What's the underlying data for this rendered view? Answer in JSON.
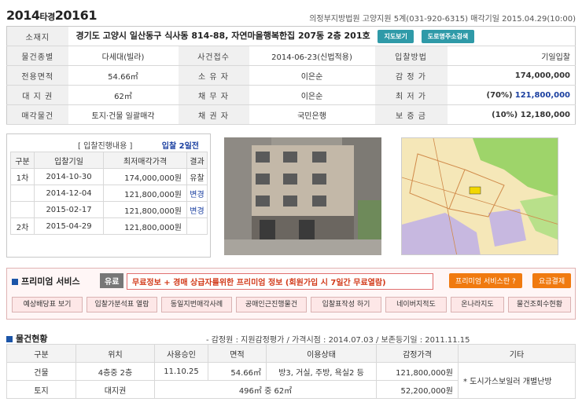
{
  "header": {
    "year": "2014",
    "type": "타경",
    "number": "20161",
    "court": "의정부지방법원 고양지원 5계(031-920-6315) 매각기일 2015.04.29(10:00)"
  },
  "info": {
    "address_label": "소재지",
    "address": "경기도 고양시 일산동구 식사동 814-88, 자연마을행복한집 207동 2층 201호",
    "map_btn": "지도보기",
    "road_btn": "도로명주소검색",
    "rows": [
      {
        "l1": "물건종별",
        "v1": "다세대(빌라)",
        "l2": "사건접수",
        "v2": "2014-06-23(신법적용)",
        "l3": "입찰방법",
        "v3": "기일입찰"
      },
      {
        "l1": "전용면적",
        "v1": "54.66㎡",
        "l2": "소 유 자",
        "v2": "이은순",
        "l3": "감 정 가",
        "v3": "174,000,000"
      },
      {
        "l1": "대 지 권",
        "v1": "62㎡",
        "l2": "채 무 자",
        "v2": "이은순",
        "l3": "최 저 가",
        "v3a": "(70%)",
        "v3b": "121,800,000"
      },
      {
        "l1": "매각물건",
        "v1": "토지·건물 일괄매각",
        "l2": "채 권 자",
        "v2": "국민은행",
        "l3": "보 증 금",
        "v3": "(10%) 12,180,000"
      }
    ]
  },
  "bid": {
    "title": "[ 입찰진행내용 ]",
    "round": "입찰 2일전",
    "headers": [
      "구분",
      "입찰기일",
      "최저매각가격",
      "결과"
    ],
    "rows": [
      {
        "div": "1차",
        "date": "2014-10-30",
        "price": "174,000,000원",
        "result": "유찰"
      },
      {
        "div": "",
        "date": "2014-12-04",
        "price": "121,800,000원",
        "result": "변경"
      },
      {
        "div": "",
        "date": "2015-02-17",
        "price": "121,800,000원",
        "result": "변경"
      },
      {
        "div": "2차",
        "date": "2015-04-29",
        "price": "121,800,000원",
        "result": ""
      }
    ]
  },
  "premium": {
    "title": "프리미엄 서비스",
    "tag": "유료",
    "message": "무료정보 + 경매 상급자를위한 프리미엄 정보 (회원가입 시 7일간 무료열람)",
    "btn_what": "프리미엄 서비스란 ?",
    "btn_pay": "요금결제",
    "services": [
      "예상배당표 보기",
      "입찰가분석표 열람",
      "동일지번매각사례",
      "공매인근진행물건",
      "입찰표작성 하기",
      "네이버지적도",
      "온나라지도",
      "물건조회수현황"
    ]
  },
  "status": {
    "title": "물건현황",
    "meta": "- 감정원 : 지원감정평가 / 가격시점 : 2014.07.03 / 보존등기일  : 2011.11.15",
    "headers": [
      "구분",
      "위치",
      "사용승인",
      "면적",
      "이용상태",
      "감정가격",
      "기타"
    ],
    "building": {
      "div": "건물",
      "loc": "4층중 2층",
      "approved": "11.10.25",
      "area": "54.66㎡",
      "use": "방3, 거실, 주방, 욕실2 등",
      "price": "121,800,000원"
    },
    "land": {
      "div": "토지",
      "loc": "대지권",
      "area": "496㎡ 중 62㎡",
      "price": "52,200,000원"
    },
    "etc": "* 도시가스보일러 개별난방"
  }
}
